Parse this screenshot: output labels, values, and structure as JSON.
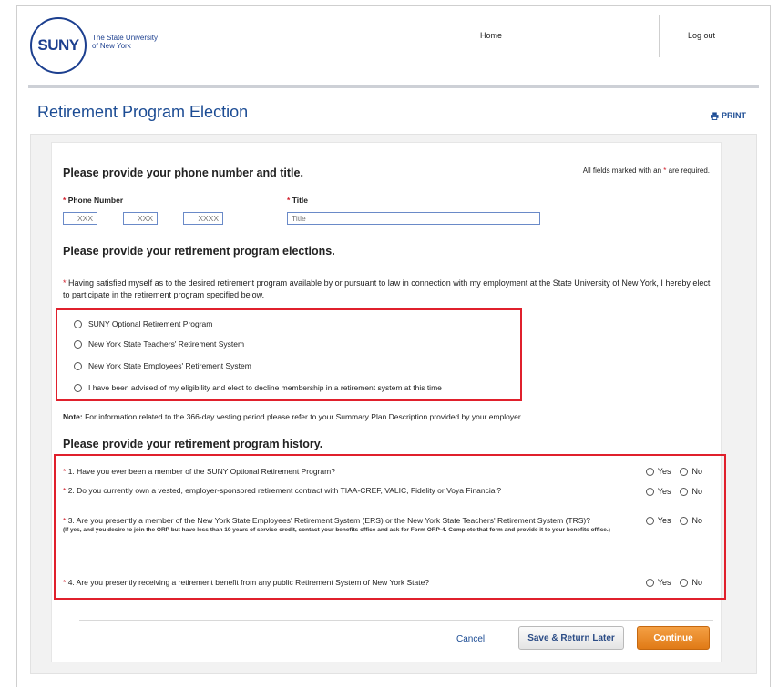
{
  "header": {
    "logo_word": "SUNY",
    "logo_sub_1": "The State University",
    "logo_sub_2": "of New York",
    "nav_home": "Home",
    "nav_logout": "Log out"
  },
  "page": {
    "title": "Retirement Program Election",
    "print_label": "PRINT"
  },
  "phone_section": {
    "heading": "Please provide your phone number and title.",
    "required_note_prefix": "All fields marked with an",
    "required_note_star": "*",
    "required_note_suffix": "are required.",
    "phone_label": "Phone Number",
    "phone_placeholders": [
      "XXX",
      "XXX",
      "XXXX"
    ],
    "title_label": "Title",
    "title_placeholder": "Title"
  },
  "elections": {
    "heading": "Please provide your retirement program elections.",
    "statement": "Having satisfied myself as to the desired retirement program available by or pursuant to law in connection with my employment at the State University of New York, I hereby elect to participate in the retirement program specified below.",
    "options": [
      "SUNY Optional Retirement Program",
      "New York State Teachers' Retirement System",
      "New York State Employees' Retirement System",
      "I have been advised of my eligibility and elect to decline membership in a retirement system at this time"
    ],
    "note_label": "Note:",
    "note_text": "For information related to the 366-day vesting period please refer to your Summary Plan Description provided by your employer."
  },
  "history": {
    "heading": "Please provide your retirement program history.",
    "yes_label": "Yes",
    "no_label": "No",
    "questions": [
      "1. Have you ever been a member of the SUNY Optional Retirement Program?",
      "2. Do you currently own a vested, employer-sponsored retirement contract with TIAA-CREF, VALIC, Fidelity or Voya Financial?",
      "3. Are you presently a member of the New York State Employees' Retirement System (ERS) or the New York State Teachers' Retirement System (TRS)?",
      "4. Are you presently receiving a retirement benefit from any public Retirement System of New York State?"
    ],
    "q3_subnote": "(If yes, and you desire to join the ORP but have less than 10 years of service credit, contact your benefits office and ask for Form ORP-4. Complete that form and provide it to your benefits office.)"
  },
  "actions": {
    "cancel": "Cancel",
    "save": "Save & Return Later",
    "continue": "Continue"
  },
  "colors": {
    "brand_blue": "#1c4c94",
    "required_red": "#d0202c",
    "highlight_red": "#e0202c",
    "continue_orange": "#e88a24"
  }
}
